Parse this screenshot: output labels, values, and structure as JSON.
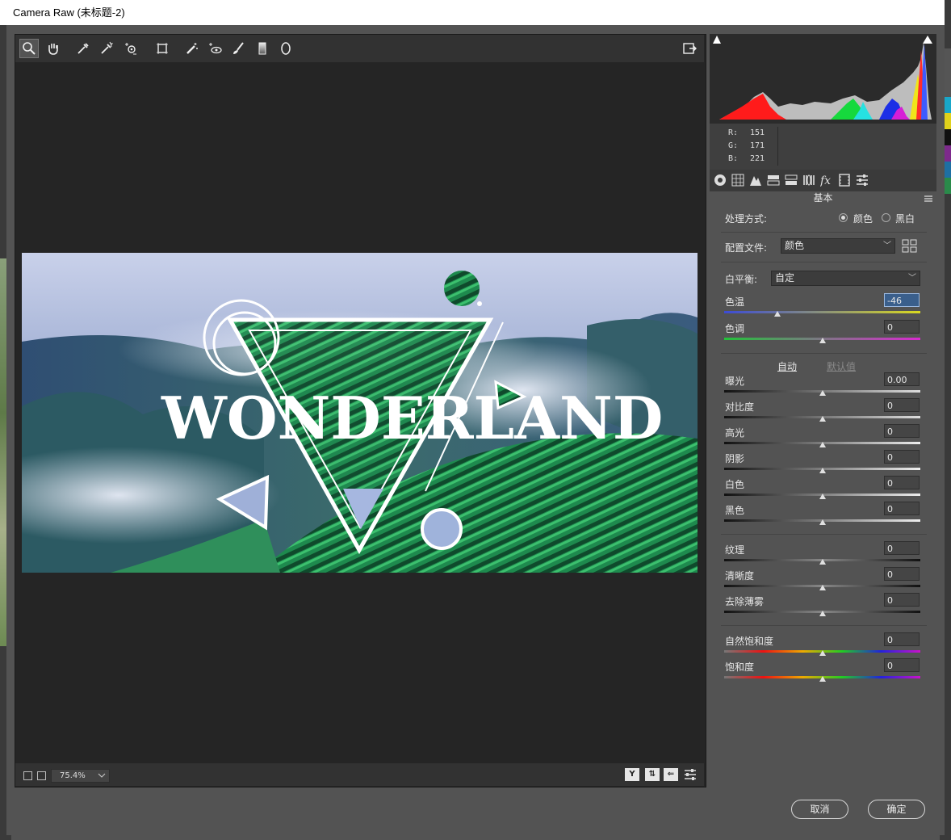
{
  "window": {
    "title": "Camera Raw (未标题-2)"
  },
  "toolbar": {
    "tools": [
      "zoom-icon",
      "hand-icon",
      "white-balance-icon",
      "color-sampler-icon",
      "targeted-adjustment-icon",
      "transform-icon",
      "spot-removal-icon",
      "red-eye-icon",
      "adjustment-brush-icon",
      "graduated-filter-icon",
      "radial-filter-icon"
    ]
  },
  "photo": {
    "headline": "WONDERLAND"
  },
  "bottom": {
    "zoom": "75.4%"
  },
  "readout": {
    "r_label": "R:",
    "r": "151",
    "g_label": "G:",
    "g": "171",
    "b_label": "B:",
    "b": "221"
  },
  "panel": {
    "title": "基本",
    "treatment_label": "处理方式:",
    "treatment_color": "颜色",
    "treatment_bw": "黑白",
    "profile_label": "配置文件:",
    "profile_value": "颜色",
    "wb_label": "白平衡:",
    "wb_value": "自定",
    "auto": "自动",
    "default": "默认值",
    "sliders": [
      {
        "label": "色温",
        "value": "-46",
        "level": 0.27
      },
      {
        "label": "色调",
        "value": "0",
        "level": 0.5
      },
      {
        "label": "曝光",
        "value": "0.00",
        "level": 0.5
      },
      {
        "label": "对比度",
        "value": "0",
        "level": 0.5
      },
      {
        "label": "高光",
        "value": "0",
        "level": 0.5
      },
      {
        "label": "阴影",
        "value": "0",
        "level": 0.5
      },
      {
        "label": "白色",
        "value": "0",
        "level": 0.5
      },
      {
        "label": "黑色",
        "value": "0",
        "level": 0.5
      },
      {
        "label": "纹理",
        "value": "0",
        "level": 0.5
      },
      {
        "label": "清晰度",
        "value": "0",
        "level": 0.5
      },
      {
        "label": "去除薄雾",
        "value": "0",
        "level": 0.5
      },
      {
        "label": "自然饱和度",
        "value": "0",
        "level": 0.5
      },
      {
        "label": "饱和度",
        "value": "0",
        "level": 0.5
      }
    ]
  },
  "buttons": {
    "cancel": "取消",
    "ok": "确定"
  },
  "colors": {
    "accent": "#3a5f8c",
    "panel": "#535353",
    "preview_bg": "#252525"
  }
}
